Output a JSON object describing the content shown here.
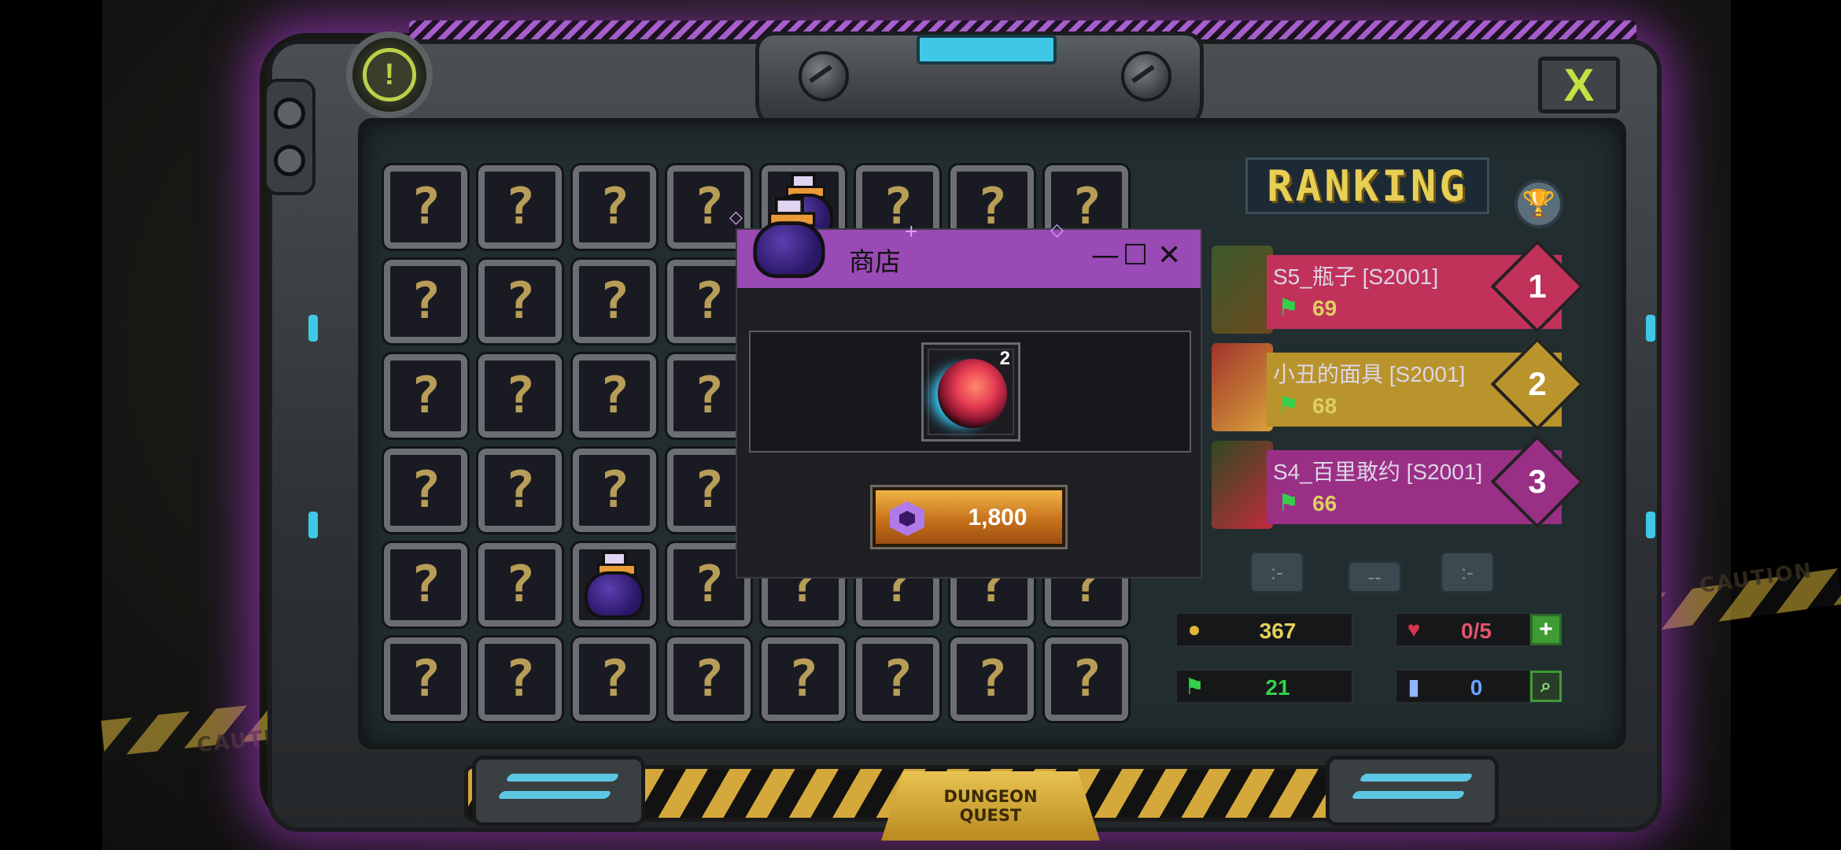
{
  "background": {
    "caution_text": "CAUTION"
  },
  "header": {
    "info_icon": "exclamation-icon",
    "close_label": "X"
  },
  "grid": {
    "unknown_symbol": "?",
    "rows": 6,
    "cols": 8,
    "potion_cells": [
      [
        0,
        4
      ],
      [
        4,
        2
      ]
    ]
  },
  "shop": {
    "title": "商店",
    "minimize": "—",
    "maximize": "☐",
    "close": "✕",
    "item": {
      "icon": "red-gem-icon",
      "quantity": "2"
    },
    "price": "1,800",
    "currency_icon": "hex-gem-icon"
  },
  "ranking": {
    "title": "RANKING",
    "entries": [
      {
        "name": "S5_瓶子 [S2001]",
        "score": "69",
        "rank": "1",
        "color": "#c0325a"
      },
      {
        "name": "小丑的面具 [S2001]",
        "score": "68",
        "rank": "2",
        "color": "#b9932c"
      },
      {
        "name": "S4_百里敢约 [S2001]",
        "score": "66",
        "rank": "3",
        "color": "#9a2f86"
      }
    ]
  },
  "stats": {
    "coins": "367",
    "hearts": "0/5",
    "flags": "21",
    "tickets": "0",
    "add_label": "+",
    "search_icon": "magnifier-icon"
  },
  "footer": {
    "line1": "DUNGEON",
    "line2": "QUEST"
  },
  "colors": {
    "accent_purple": "#9a4ab5",
    "gold": "#e7cf56",
    "cyan": "#3fc8e6"
  }
}
